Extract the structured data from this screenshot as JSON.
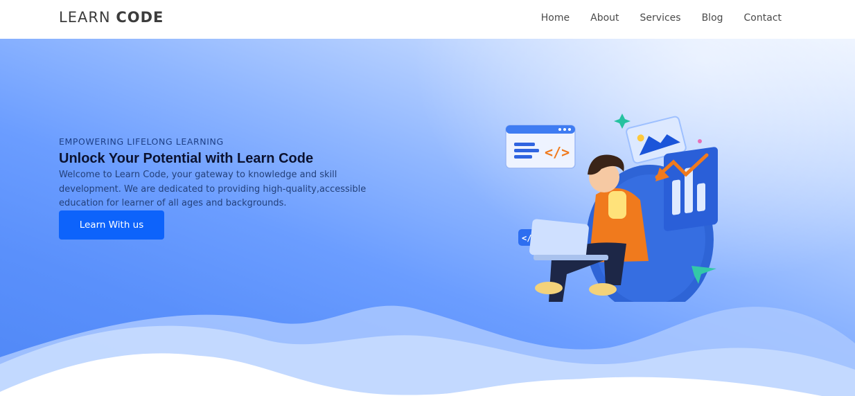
{
  "brand": {
    "light": "LEARN",
    "bold": "CODE"
  },
  "nav": {
    "items": [
      {
        "label": "Home"
      },
      {
        "label": "About"
      },
      {
        "label": "Services"
      },
      {
        "label": "Blog"
      },
      {
        "label": "Contact"
      }
    ]
  },
  "hero": {
    "eyebrow": "EMPOWERING LIFELONG LEARNING",
    "title": "Unlock Your Potential with Learn Code",
    "description": "Welcome to Learn Code, your gateway to knowledge and skill development. We are dedicated to providing high-quality,accessible education for learner of all ages and backgrounds.",
    "cta_label": "Learn With us",
    "illustration_icon": "student-with-laptop-illustration"
  },
  "colors": {
    "accent": "#0d63fb",
    "hero_start": "#e9f1ff",
    "hero_end": "#4f87f6",
    "nav_text": "#4a4a4a"
  }
}
